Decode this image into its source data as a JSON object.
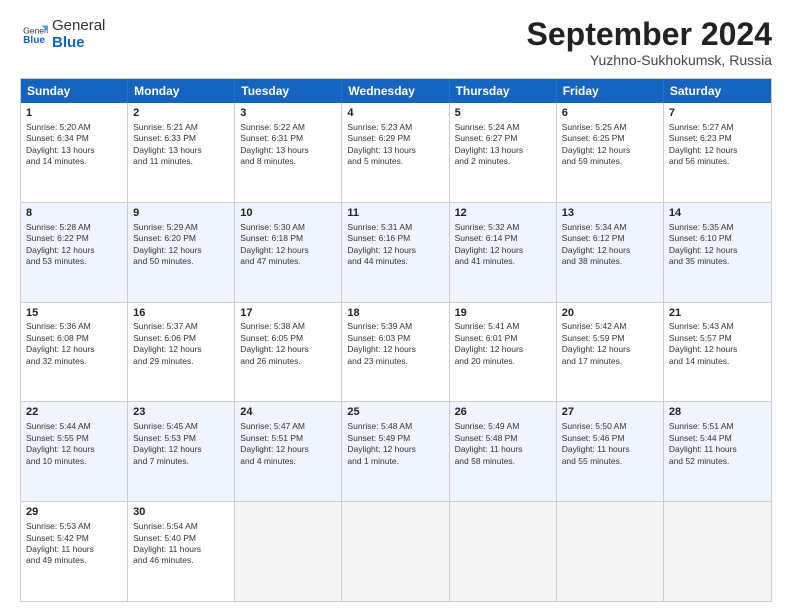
{
  "header": {
    "logo_line1": "General",
    "logo_line2": "Blue",
    "month": "September 2024",
    "location": "Yuzhno-Sukhokumsk, Russia"
  },
  "weekdays": [
    "Sunday",
    "Monday",
    "Tuesday",
    "Wednesday",
    "Thursday",
    "Friday",
    "Saturday"
  ],
  "rows": [
    [
      {
        "day": "1",
        "info": "Sunrise: 5:20 AM\nSunset: 6:34 PM\nDaylight: 13 hours\nand 14 minutes."
      },
      {
        "day": "2",
        "info": "Sunrise: 5:21 AM\nSunset: 6:33 PM\nDaylight: 13 hours\nand 11 minutes."
      },
      {
        "day": "3",
        "info": "Sunrise: 5:22 AM\nSunset: 6:31 PM\nDaylight: 13 hours\nand 8 minutes."
      },
      {
        "day": "4",
        "info": "Sunrise: 5:23 AM\nSunset: 6:29 PM\nDaylight: 13 hours\nand 5 minutes."
      },
      {
        "day": "5",
        "info": "Sunrise: 5:24 AM\nSunset: 6:27 PM\nDaylight: 13 hours\nand 2 minutes."
      },
      {
        "day": "6",
        "info": "Sunrise: 5:25 AM\nSunset: 6:25 PM\nDaylight: 12 hours\nand 59 minutes."
      },
      {
        "day": "7",
        "info": "Sunrise: 5:27 AM\nSunset: 6:23 PM\nDaylight: 12 hours\nand 56 minutes."
      }
    ],
    [
      {
        "day": "8",
        "info": "Sunrise: 5:28 AM\nSunset: 6:22 PM\nDaylight: 12 hours\nand 53 minutes."
      },
      {
        "day": "9",
        "info": "Sunrise: 5:29 AM\nSunset: 6:20 PM\nDaylight: 12 hours\nand 50 minutes."
      },
      {
        "day": "10",
        "info": "Sunrise: 5:30 AM\nSunset: 6:18 PM\nDaylight: 12 hours\nand 47 minutes."
      },
      {
        "day": "11",
        "info": "Sunrise: 5:31 AM\nSunset: 6:16 PM\nDaylight: 12 hours\nand 44 minutes."
      },
      {
        "day": "12",
        "info": "Sunrise: 5:32 AM\nSunset: 6:14 PM\nDaylight: 12 hours\nand 41 minutes."
      },
      {
        "day": "13",
        "info": "Sunrise: 5:34 AM\nSunset: 6:12 PM\nDaylight: 12 hours\nand 38 minutes."
      },
      {
        "day": "14",
        "info": "Sunrise: 5:35 AM\nSunset: 6:10 PM\nDaylight: 12 hours\nand 35 minutes."
      }
    ],
    [
      {
        "day": "15",
        "info": "Sunrise: 5:36 AM\nSunset: 6:08 PM\nDaylight: 12 hours\nand 32 minutes."
      },
      {
        "day": "16",
        "info": "Sunrise: 5:37 AM\nSunset: 6:06 PM\nDaylight: 12 hours\nand 29 minutes."
      },
      {
        "day": "17",
        "info": "Sunrise: 5:38 AM\nSunset: 6:05 PM\nDaylight: 12 hours\nand 26 minutes."
      },
      {
        "day": "18",
        "info": "Sunrise: 5:39 AM\nSunset: 6:03 PM\nDaylight: 12 hours\nand 23 minutes."
      },
      {
        "day": "19",
        "info": "Sunrise: 5:41 AM\nSunset: 6:01 PM\nDaylight: 12 hours\nand 20 minutes."
      },
      {
        "day": "20",
        "info": "Sunrise: 5:42 AM\nSunset: 5:59 PM\nDaylight: 12 hours\nand 17 minutes."
      },
      {
        "day": "21",
        "info": "Sunrise: 5:43 AM\nSunset: 5:57 PM\nDaylight: 12 hours\nand 14 minutes."
      }
    ],
    [
      {
        "day": "22",
        "info": "Sunrise: 5:44 AM\nSunset: 5:55 PM\nDaylight: 12 hours\nand 10 minutes."
      },
      {
        "day": "23",
        "info": "Sunrise: 5:45 AM\nSunset: 5:53 PM\nDaylight: 12 hours\nand 7 minutes."
      },
      {
        "day": "24",
        "info": "Sunrise: 5:47 AM\nSunset: 5:51 PM\nDaylight: 12 hours\nand 4 minutes."
      },
      {
        "day": "25",
        "info": "Sunrise: 5:48 AM\nSunset: 5:49 PM\nDaylight: 12 hours\nand 1 minute."
      },
      {
        "day": "26",
        "info": "Sunrise: 5:49 AM\nSunset: 5:48 PM\nDaylight: 11 hours\nand 58 minutes."
      },
      {
        "day": "27",
        "info": "Sunrise: 5:50 AM\nSunset: 5:46 PM\nDaylight: 11 hours\nand 55 minutes."
      },
      {
        "day": "28",
        "info": "Sunrise: 5:51 AM\nSunset: 5:44 PM\nDaylight: 11 hours\nand 52 minutes."
      }
    ],
    [
      {
        "day": "29",
        "info": "Sunrise: 5:53 AM\nSunset: 5:42 PM\nDaylight: 11 hours\nand 49 minutes."
      },
      {
        "day": "30",
        "info": "Sunrise: 5:54 AM\nSunset: 5:40 PM\nDaylight: 11 hours\nand 46 minutes."
      },
      {
        "day": "",
        "info": ""
      },
      {
        "day": "",
        "info": ""
      },
      {
        "day": "",
        "info": ""
      },
      {
        "day": "",
        "info": ""
      },
      {
        "day": "",
        "info": ""
      }
    ]
  ]
}
